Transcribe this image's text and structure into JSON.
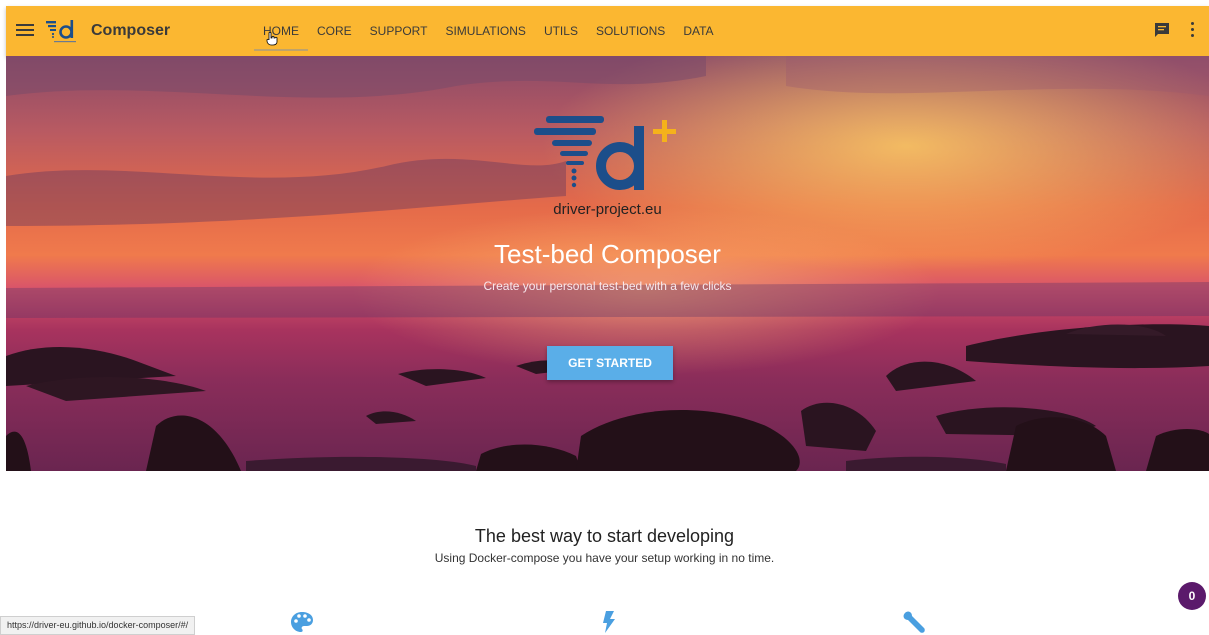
{
  "header": {
    "app_title": "Composer",
    "nav": [
      {
        "label": "HOME",
        "active": true
      },
      {
        "label": "CORE"
      },
      {
        "label": "SUPPORT"
      },
      {
        "label": "SIMULATIONS"
      },
      {
        "label": "UTILS"
      },
      {
        "label": "SOLUTIONS"
      },
      {
        "label": "DATA"
      }
    ],
    "icons": {
      "menu": "menu-icon",
      "logo": "driver-logo",
      "chat": "chat-icon",
      "more": "more-vert-icon"
    }
  },
  "hero": {
    "site_url": "driver-project.eu",
    "title": "Test-bed Composer",
    "subtitle": "Create your personal test-bed with a few clicks",
    "cta_label": "GET STARTED"
  },
  "section": {
    "title": "The best way to start developing",
    "subtitle": "Using Docker-compose you have your setup working in no time."
  },
  "features": {
    "icons": [
      "palette-icon",
      "flash-icon",
      "wrench-icon"
    ]
  },
  "status_bar": {
    "url": "https://driver-eu.github.io/docker-composer/#/"
  },
  "badge": {
    "count": "0"
  },
  "colors": {
    "topbar": "#fbb731",
    "cta": "#5aaee8",
    "badge": "#5b1a6b",
    "logo_blue": "#1c4e8a",
    "logo_plus": "#f5b21b",
    "feature_icon": "#4a9fe0"
  }
}
